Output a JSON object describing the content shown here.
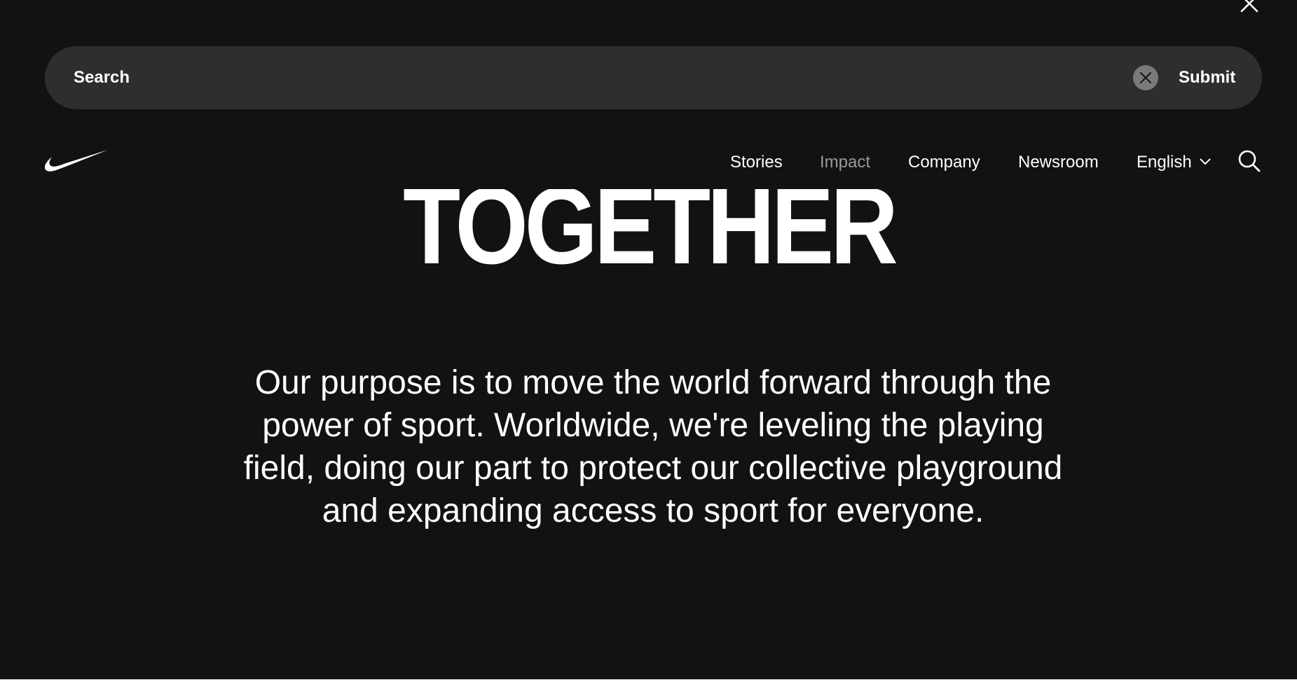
{
  "search": {
    "placeholder": "Search",
    "clear_label": "Clear search",
    "submit_label": "Submit"
  },
  "nav": {
    "items": [
      {
        "label": "Stories"
      },
      {
        "label": "Impact"
      },
      {
        "label": "Company"
      },
      {
        "label": "Newsroom"
      }
    ],
    "language": "English"
  },
  "hero": {
    "title": "TOGETHER",
    "purpose": "Our purpose is to move the world forward through the power of sport. Worldwide, we're leveling the playing field, doing our part to protect our collective playground and expanding access to sport for everyone."
  },
  "colors": {
    "background": "#121212",
    "search_bar": "#2e2e2e",
    "text": "#ffffff",
    "nav_dim": "#9a9a9a",
    "clear_button": "#7a7a7a"
  },
  "icons": [
    "close-icon",
    "clear-icon",
    "swoosh-logo",
    "chevron-down-icon",
    "search-icon"
  ]
}
